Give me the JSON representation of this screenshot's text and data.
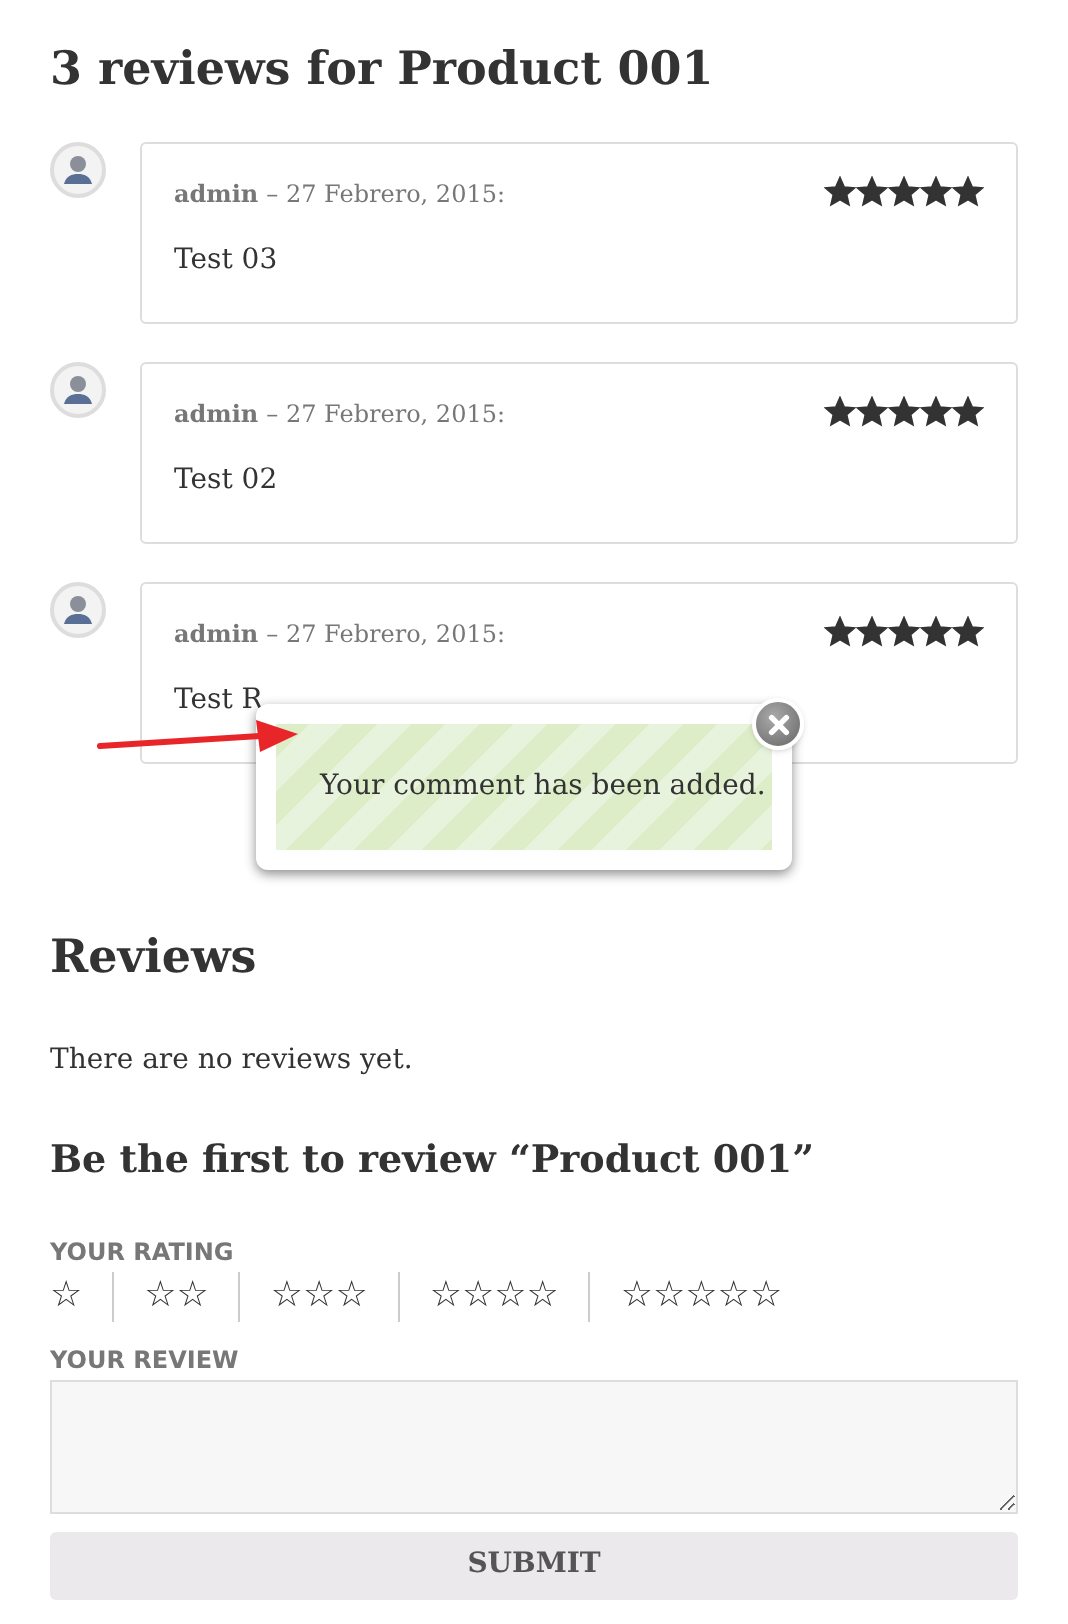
{
  "title": "3 reviews for Product 001",
  "reviews": [
    {
      "author": "admin",
      "date": "– 27 Febrero, 2015:",
      "text": "Test 03",
      "stars": 5
    },
    {
      "author": "admin",
      "date": "– 27 Febrero, 2015:",
      "text": "Test 02",
      "stars": 5
    },
    {
      "author": "admin",
      "date": "– 27 Febrero, 2015:",
      "text": "Test R",
      "stars": 5
    }
  ],
  "notice": {
    "message": "Your comment has been added."
  },
  "reviews_section": {
    "heading": "Reviews",
    "empty": "There are no reviews yet.",
    "form_title": "Be the first to review “Product 001”"
  },
  "form": {
    "rating_label": "YOUR RATING",
    "rating_options": [
      "☆",
      "☆☆",
      "☆☆☆",
      "☆☆☆☆",
      "☆☆☆☆☆"
    ],
    "review_label": "YOUR REVIEW",
    "submit": "SUBMIT"
  }
}
